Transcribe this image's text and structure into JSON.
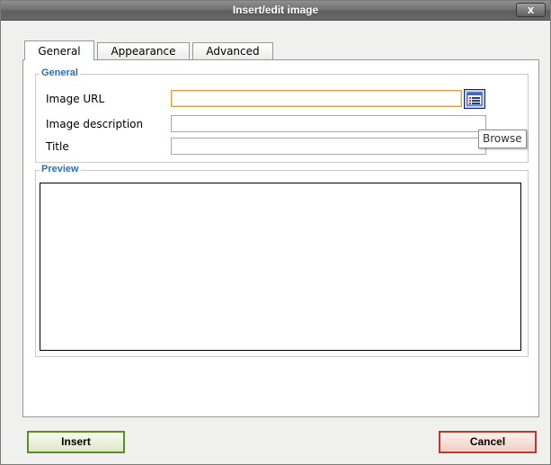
{
  "dialog": {
    "title": "Insert/edit image",
    "close_label": "x"
  },
  "tabs": [
    {
      "label": "General",
      "active": true
    },
    {
      "label": "Appearance",
      "active": false
    },
    {
      "label": "Advanced",
      "active": false
    }
  ],
  "general": {
    "legend": "General",
    "image_url_label": "Image URL",
    "image_url_value": "",
    "image_description_label": "Image description",
    "image_description_value": "",
    "title_label": "Title",
    "title_value": "",
    "browse_tooltip": "Browse"
  },
  "preview": {
    "legend": "Preview"
  },
  "buttons": {
    "insert_label": "Insert",
    "cancel_label": "Cancel"
  },
  "colors": {
    "legend": "#2b6fb6",
    "focused_border": "#d4a34a",
    "insert_border": "#5f8a2a",
    "cancel_border": "#b83c2a"
  }
}
